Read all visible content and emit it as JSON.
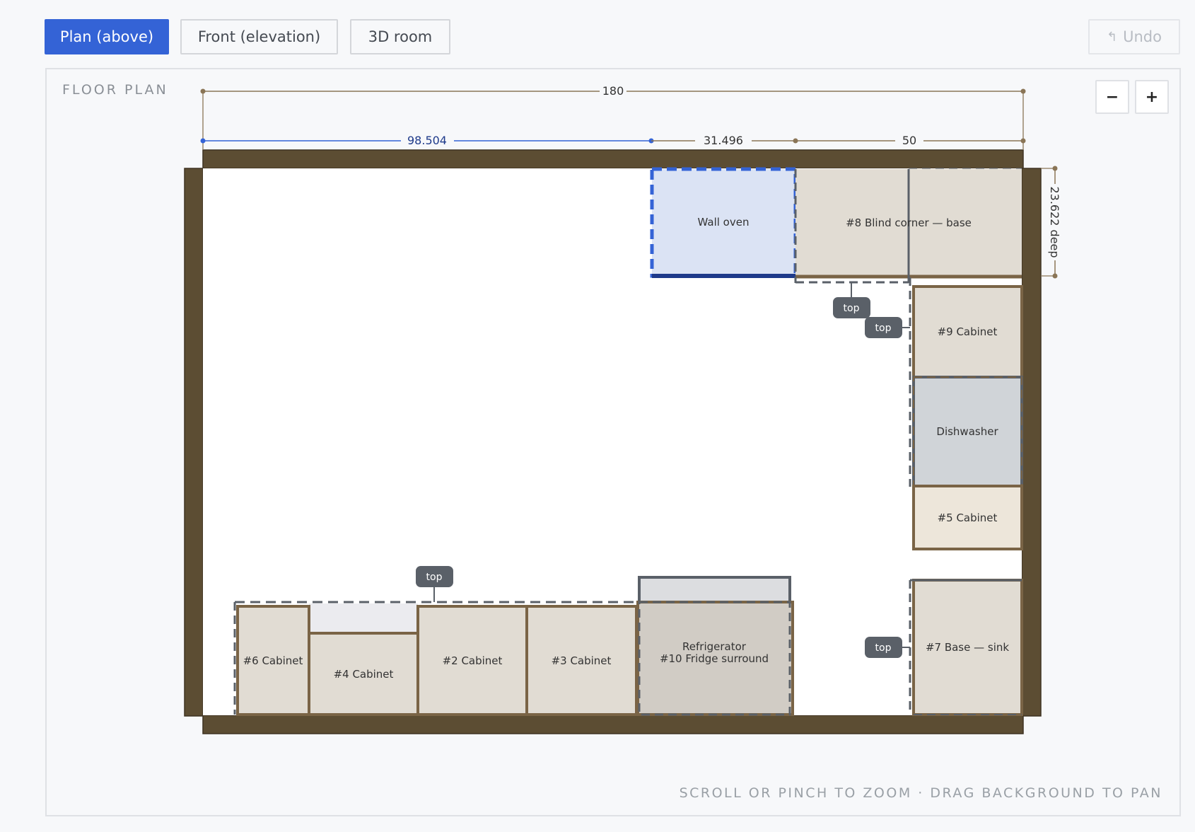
{
  "toolbar": {
    "tabs": [
      {
        "label": "Plan (above)",
        "active": true
      },
      {
        "label": "Front (elevation)",
        "active": false
      },
      {
        "label": "3D room",
        "active": false
      }
    ],
    "undo_icon": "undo-arrow-icon",
    "undo_label": "Undo"
  },
  "canvas": {
    "title": "FLOOR PLAN",
    "zoom_out_label": "−",
    "zoom_in_label": "+",
    "hint": "SCROLL OR PINCH TO ZOOM · DRAG BACKGROUND TO PAN"
  },
  "dimensions": {
    "total_width": "180",
    "segment_left": "98.504",
    "segment_middle": "31.496",
    "segment_right": "50",
    "depth": "23.622 deep"
  },
  "items": {
    "wall_oven": "Wall oven",
    "blind_corner": "#8 Blind corner — base",
    "cab9": "#9 Cabinet",
    "dishwasher": "Dishwasher",
    "cab5": "#5 Cabinet",
    "cab7": "#7 Base — sink",
    "cab6": "#6 Cabinet",
    "cab4": "#4 Cabinet",
    "cab2": "#2 Cabinet",
    "cab3": "#3 Cabinet",
    "fridge_line1": "Refrigerator",
    "fridge_line2": "#10 Fridge surround"
  },
  "top_tags": [
    "top",
    "top",
    "top",
    "top"
  ],
  "colors": {
    "accent": "#3463d6",
    "wall": "#5c4d33",
    "cabinet_fill": "#e1dcd3",
    "cabinet_stroke": "#7a6446",
    "selected_fill": "#dbe3f4",
    "selected_stroke": "#3463d6",
    "appliance_fill": "#d0d4d8",
    "tag_fill": "#5a6068"
  }
}
